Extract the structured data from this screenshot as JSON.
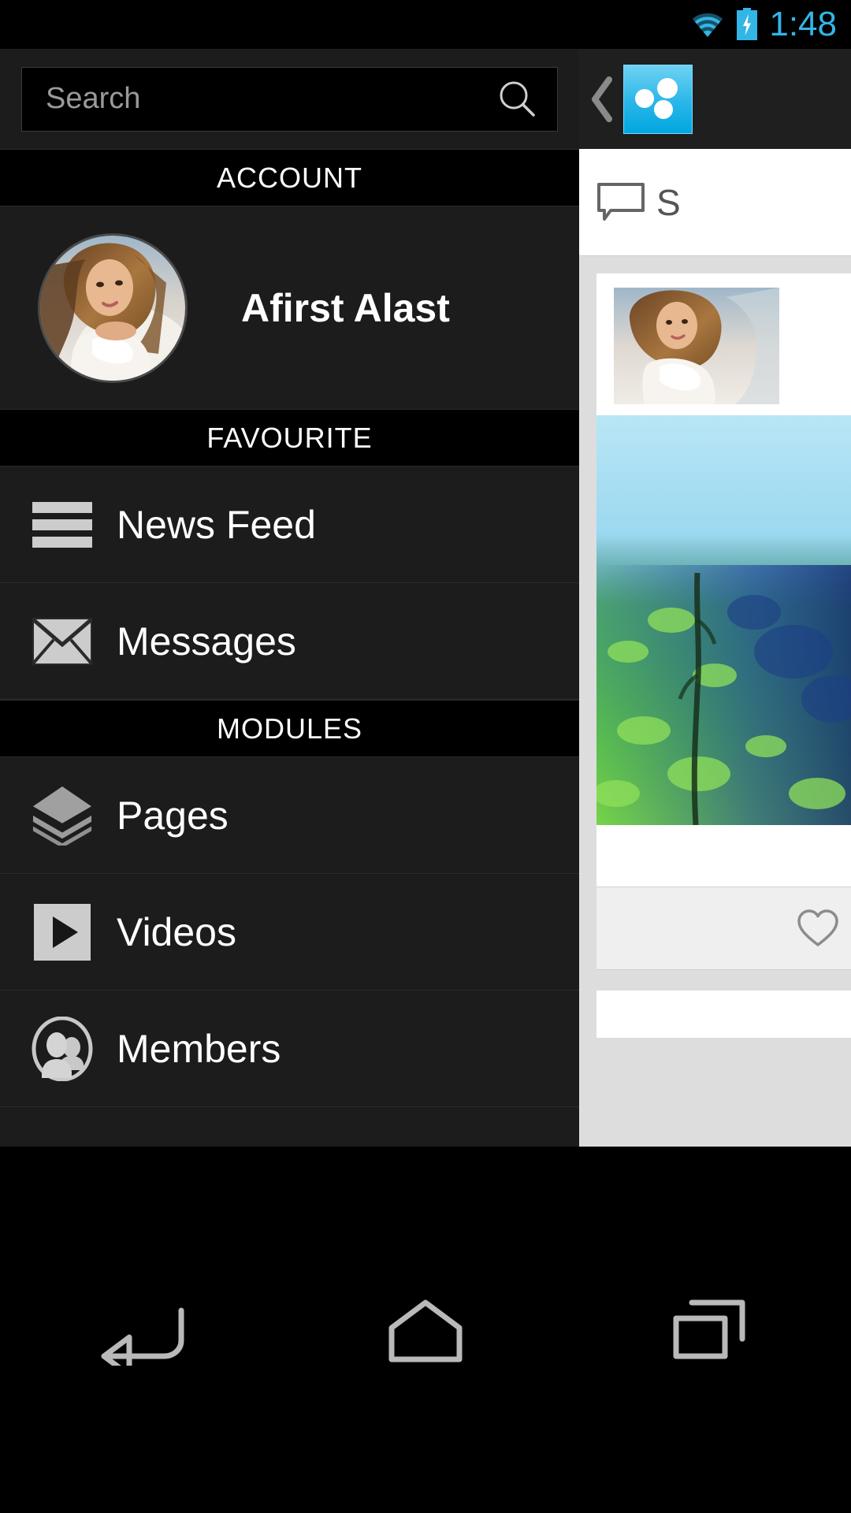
{
  "status_bar": {
    "time": "1:48",
    "wifi_icon": "wifi-icon",
    "battery_icon": "battery-charging-icon",
    "accent_color": "#33b5e5"
  },
  "drawer": {
    "search": {
      "placeholder": "Search",
      "value": "",
      "icon": "search-icon"
    },
    "sections": [
      {
        "header": "ACCOUNT",
        "account": {
          "name": "Afirst Alast",
          "avatar": "user-avatar"
        }
      },
      {
        "header": "FAVOURITE",
        "items": [
          {
            "label": "News Feed",
            "icon": "news-feed-icon"
          },
          {
            "label": "Messages",
            "icon": "envelope-icon"
          }
        ]
      },
      {
        "header": "MODULES",
        "items": [
          {
            "label": "Pages",
            "icon": "layers-icon"
          },
          {
            "label": "Videos",
            "icon": "play-icon"
          },
          {
            "label": "Members",
            "icon": "members-icon"
          }
        ]
      }
    ]
  },
  "content_panel": {
    "back_icon": "back-chevron-icon",
    "app_logo": "app-logo-icon",
    "tab": {
      "label": "S",
      "icon": "speech-bubble-icon"
    },
    "post": {
      "thumbnail": "post-author-thumbnail",
      "photo": "post-landscape-photo",
      "like_icon": "heart-outline-icon"
    },
    "background_color": "#dddddd"
  },
  "nav_bar": {
    "buttons": [
      {
        "name": "back",
        "icon": "back-arrow-icon"
      },
      {
        "name": "home",
        "icon": "home-icon"
      },
      {
        "name": "recents",
        "icon": "recents-icon"
      }
    ]
  }
}
